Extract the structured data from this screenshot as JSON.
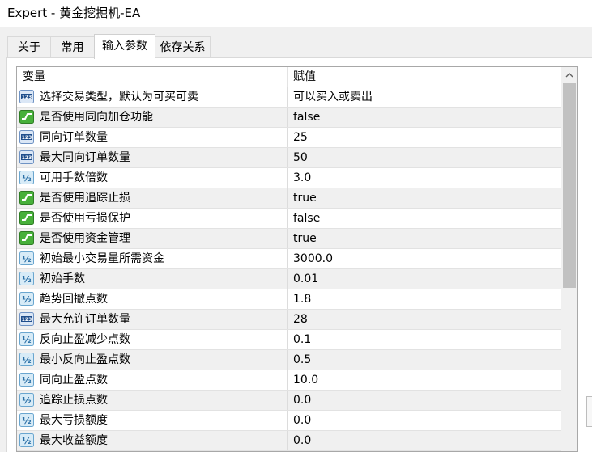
{
  "window": {
    "title": "Expert - 黄金挖掘机-EA"
  },
  "tabs": [
    {
      "label": "关于"
    },
    {
      "label": "常用"
    },
    {
      "label": "输入参数"
    },
    {
      "label": "依存关系"
    }
  ],
  "grid": {
    "col_variable": "变量",
    "col_value": "赋值",
    "rows": [
      {
        "icon": "integer-icon",
        "name": "选择交易类型，默认为可买可卖",
        "value": "可以买入或卖出"
      },
      {
        "icon": "boolean-icon",
        "name": "是否使用同向加仓功能",
        "value": "false"
      },
      {
        "icon": "integer-icon",
        "name": "同向订单数量",
        "value": "25"
      },
      {
        "icon": "integer-icon",
        "name": "最大同向订单数量",
        "value": "50"
      },
      {
        "icon": "double-icon",
        "name": "可用手数倍数",
        "value": "3.0"
      },
      {
        "icon": "boolean-icon",
        "name": "是否使用追踪止损",
        "value": "true"
      },
      {
        "icon": "boolean-icon",
        "name": "是否使用亏损保护",
        "value": "false"
      },
      {
        "icon": "boolean-icon",
        "name": "是否使用资金管理",
        "value": "true"
      },
      {
        "icon": "double-icon",
        "name": "初始最小交易量所需资金",
        "value": "3000.0"
      },
      {
        "icon": "double-icon",
        "name": "初始手数",
        "value": "0.01"
      },
      {
        "icon": "double-icon",
        "name": "趋势回撤点数",
        "value": "1.8"
      },
      {
        "icon": "integer-icon",
        "name": "最大允许订单数量",
        "value": "28"
      },
      {
        "icon": "double-icon",
        "name": "反向止盈减少点数",
        "value": "0.1"
      },
      {
        "icon": "double-icon",
        "name": "最小反向止盈点数",
        "value": "0.5"
      },
      {
        "icon": "double-icon",
        "name": "同向止盈点数",
        "value": "10.0"
      },
      {
        "icon": "double-icon",
        "name": "追踪止损点数",
        "value": "0.0"
      },
      {
        "icon": "double-icon",
        "name": "最大亏损额度",
        "value": "0.0"
      },
      {
        "icon": "double-icon",
        "name": "最大收益额度",
        "value": "0.0"
      }
    ]
  },
  "icons": {
    "integer_glyph": "123",
    "double_glyph": "½"
  },
  "colors": {
    "integer_icon_bg": "#dbe7f6",
    "integer_icon_fg": "#1f4e8c",
    "double_icon_bg": "#d7ebf7",
    "double_icon_fg": "#2a6fa6",
    "boolean_icon_bg": "#47b03a",
    "row_alt": "#f0f0f0"
  }
}
